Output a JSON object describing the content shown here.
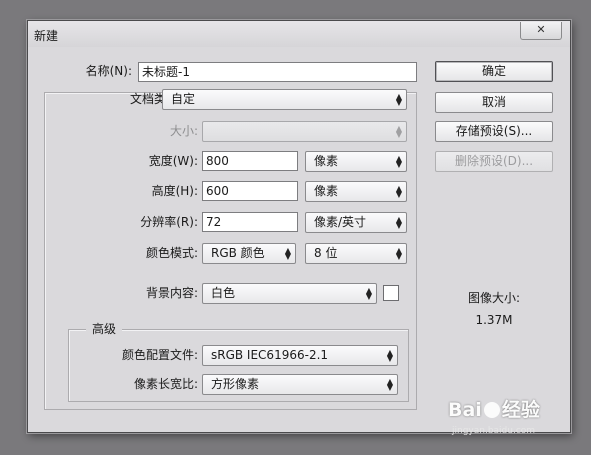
{
  "window": {
    "title": "新建",
    "close_icon": "✕"
  },
  "form": {
    "name_label": "名称(N):",
    "name_value": "未标题-1",
    "doc_type_label": "文档类型:",
    "doc_type_value": "自定",
    "size_label": "大小:",
    "size_value": "",
    "width_label": "宽度(W):",
    "width_value": "800",
    "width_unit": "像素",
    "height_label": "高度(H):",
    "height_value": "600",
    "height_unit": "像素",
    "resolution_label": "分辨率(R):",
    "resolution_value": "72",
    "resolution_unit": "像素/英寸",
    "color_mode_label": "颜色模式:",
    "color_mode_value": "RGB 颜色",
    "bit_depth_value": "8 位",
    "background_label": "背景内容:",
    "background_value": "白色",
    "background_swatch_color": "#ffffff"
  },
  "advanced": {
    "title": "高级",
    "color_profile_label": "颜色配置文件:",
    "color_profile_value": "sRGB IEC61966-2.1",
    "pixel_aspect_label": "像素长宽比:",
    "pixel_aspect_value": "方形像素"
  },
  "buttons": {
    "ok": "确定",
    "cancel": "取消",
    "save_preset": "存储预设(S)...",
    "delete_preset": "删除预设(D)..."
  },
  "image_size": {
    "label": "图像大小:",
    "value": "1.37M"
  },
  "watermark": {
    "logo_left": "Bai",
    "logo_right": "经验",
    "url": "jingyan.baidu.com"
  }
}
